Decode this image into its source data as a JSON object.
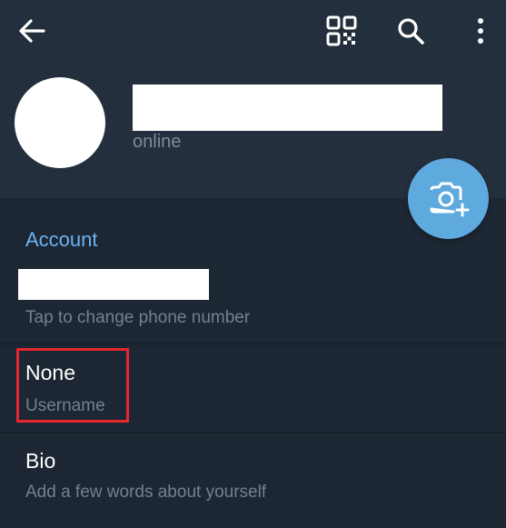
{
  "profile": {
    "status": "online"
  },
  "toolbar": {
    "back_icon": "arrow-left",
    "qr_icon": "qr-code",
    "search_icon": "magnifier",
    "more_icon": "three-dots-vertical"
  },
  "camera_fab": {
    "icon": "camera-plus",
    "color": "#5eaadf"
  },
  "account": {
    "title": "Account",
    "phone_hint": "Tap to change phone number",
    "username_value": "None",
    "username_label": "Username",
    "bio_label": "Bio",
    "bio_hint": "Add a few words about yourself"
  },
  "colors": {
    "header_bg": "#242f3d",
    "body_bg": "#1d2733",
    "accent": "#6ab3f3",
    "highlight": "#e5262d"
  }
}
